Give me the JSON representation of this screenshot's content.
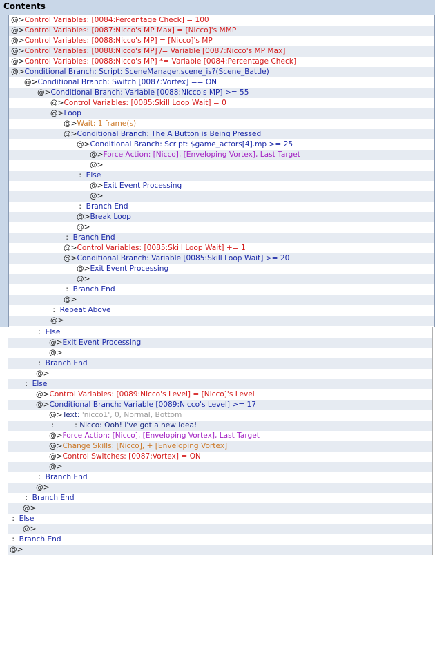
{
  "window": {
    "title": "Contents"
  },
  "colors": {
    "red": "#d41c1c",
    "blue": "#1c2aa8",
    "purple": "#a424c4",
    "orange": "#cc7a2a",
    "gray": "#9a9a9a"
  },
  "rows": [
    {
      "i": 0,
      "s": [
        [
          "@>",
          "dark"
        ],
        [
          "Control Variables: [0084:Percentage Check] = 100",
          "red"
        ]
      ]
    },
    {
      "i": 0,
      "s": [
        [
          "@>",
          "dark"
        ],
        [
          "Control Variables: [0087:Nicco's MP Max] = [Nicco]'s MMP",
          "red"
        ]
      ]
    },
    {
      "i": 0,
      "s": [
        [
          "@>",
          "dark"
        ],
        [
          "Control Variables: [0088:Nicco's MP] = [Nicco]'s MP",
          "red"
        ]
      ]
    },
    {
      "i": 0,
      "s": [
        [
          "@>",
          "dark"
        ],
        [
          "Control Variables: [0088:Nicco's MP] /= Variable [0087:Nicco's MP Max]",
          "red"
        ]
      ]
    },
    {
      "i": 0,
      "s": [
        [
          "@>",
          "dark"
        ],
        [
          "Control Variables: [0088:Nicco's MP] *= Variable [0084:Percentage Check]",
          "red"
        ]
      ]
    },
    {
      "i": 0,
      "s": [
        [
          "@>",
          "dark"
        ],
        [
          "Conditional Branch: Script: SceneManager.scene_is?(Scene_Battle)",
          "blue"
        ]
      ]
    },
    {
      "i": 1,
      "s": [
        [
          "@>",
          "dark"
        ],
        [
          "Conditional Branch: Switch [0087:Vortex] == ON",
          "blue"
        ]
      ]
    },
    {
      "i": 2,
      "s": [
        [
          "@>",
          "dark"
        ],
        [
          "Conditional Branch: Variable [0088:Nicco's MP] >= 55",
          "blue"
        ]
      ]
    },
    {
      "i": 3,
      "s": [
        [
          "@>",
          "dark"
        ],
        [
          "Control Variables: [0085:Skill Loop Wait] = 0",
          "red"
        ]
      ]
    },
    {
      "i": 3,
      "s": [
        [
          "@>",
          "dark"
        ],
        [
          "Loop",
          "blue"
        ]
      ]
    },
    {
      "i": 4,
      "s": [
        [
          "@>",
          "dark"
        ],
        [
          "Wait: 1 frame(s)",
          "orange"
        ]
      ]
    },
    {
      "i": 4,
      "s": [
        [
          "@>",
          "dark"
        ],
        [
          "Conditional Branch: The A Button is Being Pressed",
          "blue"
        ]
      ]
    },
    {
      "i": 5,
      "s": [
        [
          "@>",
          "dark"
        ],
        [
          "Conditional Branch: Script: $game_actors[4].mp >= 25",
          "blue"
        ]
      ]
    },
    {
      "i": 6,
      "s": [
        [
          "@>",
          "dark"
        ],
        [
          "Force Action: [Nicco], [Enveloping Vortex], Last Target",
          "purple"
        ]
      ]
    },
    {
      "i": 6,
      "s": [
        [
          "@>",
          "dark"
        ]
      ]
    },
    {
      "i": 5,
      "s": [
        [
          " :  ",
          "dark"
        ],
        [
          "Else",
          "blue"
        ]
      ]
    },
    {
      "i": 6,
      "s": [
        [
          "@>",
          "dark"
        ],
        [
          "Exit Event Processing",
          "blue"
        ]
      ]
    },
    {
      "i": 6,
      "s": [
        [
          "@>",
          "dark"
        ]
      ]
    },
    {
      "i": 5,
      "s": [
        [
          " :  ",
          "dark"
        ],
        [
          "Branch End",
          "blue"
        ]
      ]
    },
    {
      "i": 5,
      "s": [
        [
          "@>",
          "dark"
        ],
        [
          "Break Loop",
          "blue"
        ]
      ]
    },
    {
      "i": 5,
      "s": [
        [
          "@>",
          "dark"
        ]
      ]
    },
    {
      "i": 4,
      "s": [
        [
          " :  ",
          "dark"
        ],
        [
          "Branch End",
          "blue"
        ]
      ]
    },
    {
      "i": 4,
      "s": [
        [
          "@>",
          "dark"
        ],
        [
          "Control Variables: [0085:Skill Loop Wait] += 1",
          "red"
        ]
      ]
    },
    {
      "i": 4,
      "s": [
        [
          "@>",
          "dark"
        ],
        [
          "Conditional Branch: Variable [0085:Skill Loop Wait] >= 20",
          "blue"
        ]
      ]
    },
    {
      "i": 5,
      "s": [
        [
          "@>",
          "dark"
        ],
        [
          "Exit Event Processing",
          "blue"
        ]
      ]
    },
    {
      "i": 5,
      "s": [
        [
          "@>",
          "dark"
        ]
      ]
    },
    {
      "i": 4,
      "s": [
        [
          " :  ",
          "dark"
        ],
        [
          "Branch End",
          "blue"
        ]
      ]
    },
    {
      "i": 4,
      "s": [
        [
          "@>",
          "dark"
        ]
      ]
    },
    {
      "i": 3,
      "s": [
        [
          " :  ",
          "dark"
        ],
        [
          "Repeat Above",
          "blue"
        ]
      ]
    },
    {
      "i": 3,
      "s": [
        [
          "@>",
          "dark"
        ]
      ]
    },
    {
      "i": 2,
      "s": [
        [
          " :  ",
          "dark"
        ],
        [
          "Else",
          "blue"
        ]
      ]
    },
    {
      "i": 3,
      "s": [
        [
          "@>",
          "dark"
        ],
        [
          "Exit Event Processing",
          "blue"
        ]
      ]
    },
    {
      "i": 3,
      "s": [
        [
          "@>",
          "dark"
        ]
      ]
    },
    {
      "i": 2,
      "s": [
        [
          " :  ",
          "dark"
        ],
        [
          "Branch End",
          "blue"
        ]
      ]
    },
    {
      "i": 2,
      "s": [
        [
          "@>",
          "dark"
        ]
      ]
    },
    {
      "i": 1,
      "s": [
        [
          " :  ",
          "dark"
        ],
        [
          "Else",
          "blue"
        ]
      ]
    },
    {
      "i": 2,
      "s": [
        [
          "@>",
          "dark"
        ],
        [
          "Control Variables: [0089:Nicco's Level] = [Nicco]'s Level",
          "red"
        ]
      ]
    },
    {
      "i": 2,
      "s": [
        [
          "@>",
          "dark"
        ],
        [
          "Conditional Branch: Variable [0089:Nicco's Level] >= 17",
          "blue"
        ]
      ]
    },
    {
      "i": 3,
      "s": [
        [
          "@>",
          "dark"
        ],
        [
          "Text: ",
          "navy"
        ],
        [
          "'nicco1', 0, Normal, Bottom",
          "gray"
        ]
      ]
    },
    {
      "i": 3,
      "s": [
        [
          " :         : ",
          "dark"
        ],
        [
          "Nicco: Ooh! I've got a new idea!",
          "navy"
        ]
      ]
    },
    {
      "i": 3,
      "s": [
        [
          "@>",
          "dark"
        ],
        [
          "Force Action: [Nicco], [Enveloping Vortex], Last Target",
          "purple"
        ]
      ]
    },
    {
      "i": 3,
      "s": [
        [
          "@>",
          "dark"
        ],
        [
          "Change Skills: [Nicco], + [Enveloping Vortex]",
          "orange"
        ]
      ]
    },
    {
      "i": 3,
      "s": [
        [
          "@>",
          "dark"
        ],
        [
          "Control Switches: [0087:Vortex] = ON",
          "red"
        ]
      ]
    },
    {
      "i": 3,
      "s": [
        [
          "@>",
          "dark"
        ]
      ]
    },
    {
      "i": 2,
      "s": [
        [
          " :  ",
          "dark"
        ],
        [
          "Branch End",
          "blue"
        ]
      ]
    },
    {
      "i": 2,
      "s": [
        [
          "@>",
          "dark"
        ]
      ]
    },
    {
      "i": 1,
      "s": [
        [
          " :  ",
          "dark"
        ],
        [
          "Branch End",
          "blue"
        ]
      ]
    },
    {
      "i": 1,
      "s": [
        [
          "@>",
          "dark"
        ]
      ]
    },
    {
      "i": 0,
      "s": [
        [
          " :  ",
          "dark"
        ],
        [
          "Else",
          "blue"
        ]
      ]
    },
    {
      "i": 1,
      "s": [
        [
          "@>",
          "dark"
        ]
      ]
    },
    {
      "i": 0,
      "s": [
        [
          " :  ",
          "dark"
        ],
        [
          "Branch End",
          "blue"
        ]
      ]
    },
    {
      "i": 0,
      "s": [
        [
          "@>",
          "dark"
        ]
      ]
    }
  ]
}
